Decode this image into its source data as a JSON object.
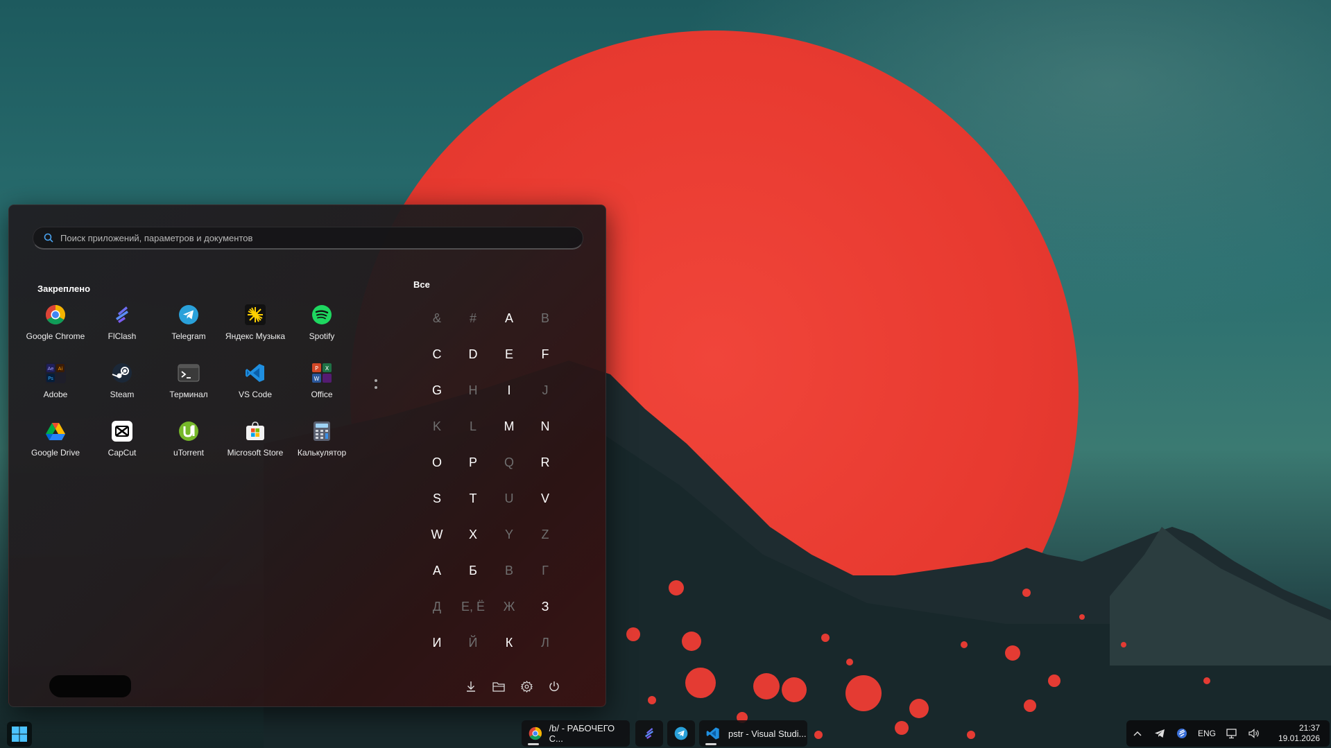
{
  "search": {
    "placeholder": "Поиск приложений, параметров и документов"
  },
  "pinned": {
    "title": "Закреплено",
    "apps": [
      {
        "label": "Google Chrome",
        "icon": "chrome-icon"
      },
      {
        "label": "FlClash",
        "icon": "flclash-icon"
      },
      {
        "label": "Telegram",
        "icon": "telegram-icon"
      },
      {
        "label": "Яндекс Музыка",
        "icon": "yandex-music-icon"
      },
      {
        "label": "Spotify",
        "icon": "spotify-icon"
      },
      {
        "label": "Adobe",
        "icon": "adobe-icon"
      },
      {
        "label": "Steam",
        "icon": "steam-icon"
      },
      {
        "label": "Терминал",
        "icon": "terminal-icon"
      },
      {
        "label": "VS Code",
        "icon": "vscode-icon"
      },
      {
        "label": "Office",
        "icon": "office-icon"
      },
      {
        "label": "Google Drive",
        "icon": "google-drive-icon"
      },
      {
        "label": "CapCut",
        "icon": "capcut-icon"
      },
      {
        "label": "uTorrent",
        "icon": "utorrent-icon"
      },
      {
        "label": "Microsoft Store",
        "icon": "ms-store-icon"
      },
      {
        "label": "Калькулятор",
        "icon": "calculator-icon"
      }
    ]
  },
  "all": {
    "title": "Все",
    "letters": [
      {
        "c": "&",
        "on": false
      },
      {
        "c": "#",
        "on": false
      },
      {
        "c": "A",
        "on": true
      },
      {
        "c": "B",
        "on": false
      },
      {
        "c": "C",
        "on": true
      },
      {
        "c": "D",
        "on": true
      },
      {
        "c": "E",
        "on": true
      },
      {
        "c": "F",
        "on": true
      },
      {
        "c": "G",
        "on": true
      },
      {
        "c": "H",
        "on": false
      },
      {
        "c": "I",
        "on": true
      },
      {
        "c": "J",
        "on": false
      },
      {
        "c": "K",
        "on": false
      },
      {
        "c": "L",
        "on": false
      },
      {
        "c": "M",
        "on": true
      },
      {
        "c": "N",
        "on": true
      },
      {
        "c": "O",
        "on": true
      },
      {
        "c": "P",
        "on": true
      },
      {
        "c": "Q",
        "on": false
      },
      {
        "c": "R",
        "on": true
      },
      {
        "c": "S",
        "on": true
      },
      {
        "c": "T",
        "on": true
      },
      {
        "c": "U",
        "on": false
      },
      {
        "c": "V",
        "on": true
      },
      {
        "c": "W",
        "on": true
      },
      {
        "c": "X",
        "on": true
      },
      {
        "c": "Y",
        "on": false
      },
      {
        "c": "Z",
        "on": false
      },
      {
        "c": "А",
        "on": true
      },
      {
        "c": "Б",
        "on": true
      },
      {
        "c": "В",
        "on": false
      },
      {
        "c": "Г",
        "on": false
      },
      {
        "c": "Д",
        "on": false
      },
      {
        "c": "Е, Ё",
        "on": false
      },
      {
        "c": "Ж",
        "on": false
      },
      {
        "c": "З",
        "on": true
      },
      {
        "c": "И",
        "on": true
      },
      {
        "c": "Й",
        "on": false
      },
      {
        "c": "К",
        "on": true
      },
      {
        "c": "Л",
        "on": false
      }
    ]
  },
  "taskbar": {
    "chrome_title": "/b/ - РАБОЧЕГО С...",
    "vscode_title": "pstr - Visual Studi...",
    "lang": "ENG",
    "time": "21:37",
    "date": "19.01.2026"
  },
  "colors": {
    "accent": "#3a8ee6",
    "sun": "#e83a30"
  }
}
